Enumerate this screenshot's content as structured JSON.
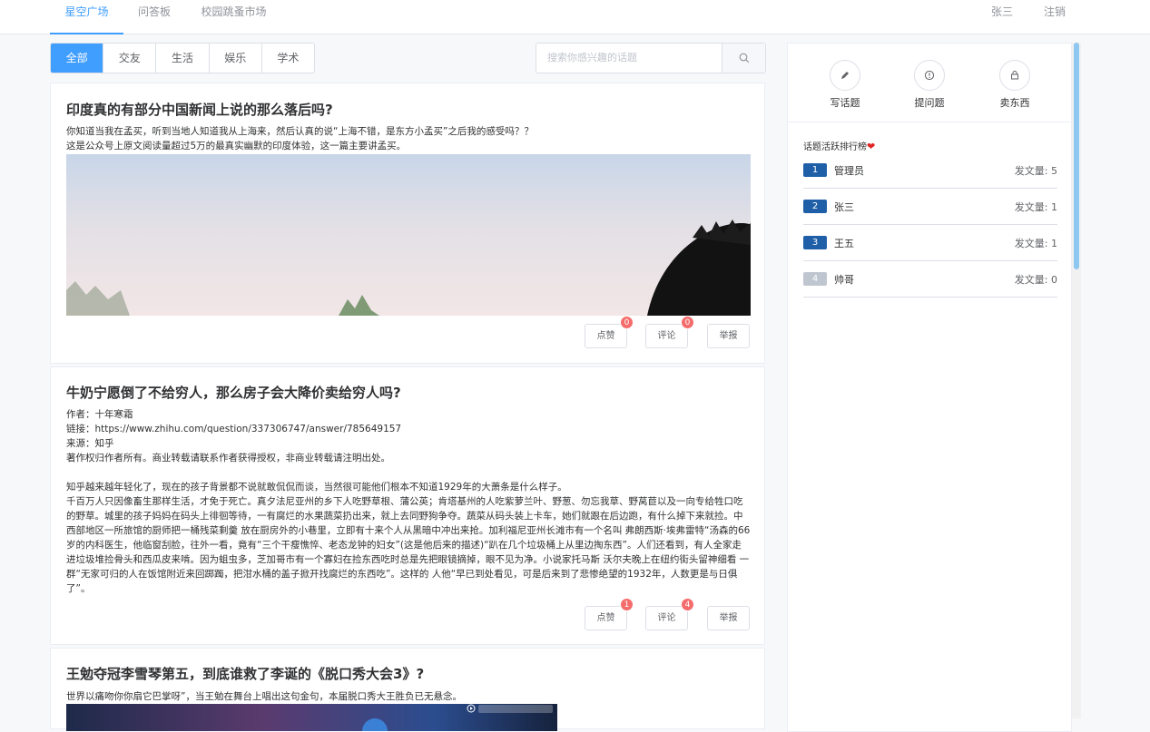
{
  "nav": {
    "tabs": [
      {
        "label": "星空广场"
      },
      {
        "label": "问答板"
      },
      {
        "label": "校园跳蚤市场"
      }
    ],
    "user": "张三",
    "logout": "注销"
  },
  "filters": [
    "全部",
    "交友",
    "生活",
    "娱乐",
    "学术"
  ],
  "search": {
    "placeholder": "搜索你感兴趣的话题"
  },
  "posts": [
    {
      "title": "印度真的有部分中国新闻上说的那么落后吗?",
      "body": "你知道当我在孟买，听到当地人知道我从上海来，然后认真的说“上海不错，是东方小孟买”之后我的感受吗？？\n这是公众号上原文阅读量超过5万的最真实幽默的印度体验，这一篇主要讲孟买。",
      "like_label": "点赞",
      "like_count": "0",
      "comment_label": "评论",
      "comment_count": "0",
      "report_label": "举报"
    },
    {
      "title": "牛奶宁愿倒了不给穷人，那么房子会大降价卖给穷人吗?",
      "body": "作者：十年寒霜\n链接：https://www.zhihu.com/question/337306747/answer/785649157\n来源：知乎\n著作权归作者所有。商业转载请联系作者获得授权，非商业转载请注明出处。\n\n知乎越来越年轻化了，现在的孩子背景都不说就敢侃侃而谈，当然很可能他们根本不知道1929年的大萧条是什么样子。\n千百万人只因像畜生那样生活，才免于死亡。真夕法尼亚州的乡下人吃野草根、蒲公英；肯塔基州的人吃紫萝兰叶、野葱、勿忘我草、野莴苣以及一向专给牲口吃的野草。城里的孩子妈妈在码头上徘徊等待，一有腐烂的水果蔬菜扔出来，就上去同野狗争夺。蔬菜从码头装上卡车，她们就跟在后边跑，有什么掉下来就捡。中西部地区一所旅馆的厨师把一桶残菜剩羹 放在厨房外的小巷里，立即有十来个人从黑暗中冲出来抢。加利福尼亚州长滩市有一个名叫 弗朗西斯·埃弗雷特“汤森的66岁的内科医生，他临窗刮脸，往外一看，竟有“三个干瘦憔悴、老态龙钟的妇女”(这是他后来的描述)“趴在几个垃圾桶上从里边掏东西”。人们还看到，有人全家走进垃圾堆捡骨头和西瓜皮来啃。因为蛆虫多，芝加哥市有一个寡妇在捡东西吃时总是先把眼镜摘掉，眼不见为净。小说家托马斯 沃尔夫晚上在纽约街头留神细看 一群“无家可归的人在饭馆附近来回踯躅，把泔水桶的盖子掀开找腐烂的东西吃”。这样的 人他“早已到处看见，可是后来到了悲惨绝望的1932年，人数更是与日俱了”。",
      "like_label": "点赞",
      "like_count": "1",
      "comment_label": "评论",
      "comment_count": "4",
      "report_label": "举报"
    },
    {
      "title": "王勉夺冠李雪琴第五，到底谁救了李诞的《脱口秀大会3》?",
      "body": "世界以痛吻你你扇它巴掌呀”，当王勉在舞台上唱出这句金句，本届脱口秀大王胜负已无悬念。"
    }
  ],
  "sidebar": {
    "actions": [
      {
        "label": "写话题",
        "icon": "pencil-icon"
      },
      {
        "label": "提问题",
        "icon": "info-icon"
      },
      {
        "label": "卖东西",
        "icon": "bag-icon"
      }
    ],
    "ranking_title": "话题活跃排行榜",
    "ranking": [
      {
        "rank": "1",
        "name": "管理员",
        "count": "发文量: 5",
        "color": "#1f5fa8"
      },
      {
        "rank": "2",
        "name": "张三",
        "count": "发文量: 1",
        "color": "#1f5fa8"
      },
      {
        "rank": "3",
        "name": "王五",
        "count": "发文量: 1",
        "color": "#1f5fa8"
      },
      {
        "rank": "4",
        "name": "帅哥",
        "count": "发文量: 0",
        "color": "#c0c6d0"
      }
    ]
  },
  "colors": {
    "accent": "#409eff",
    "badge": "#f56c6c"
  }
}
